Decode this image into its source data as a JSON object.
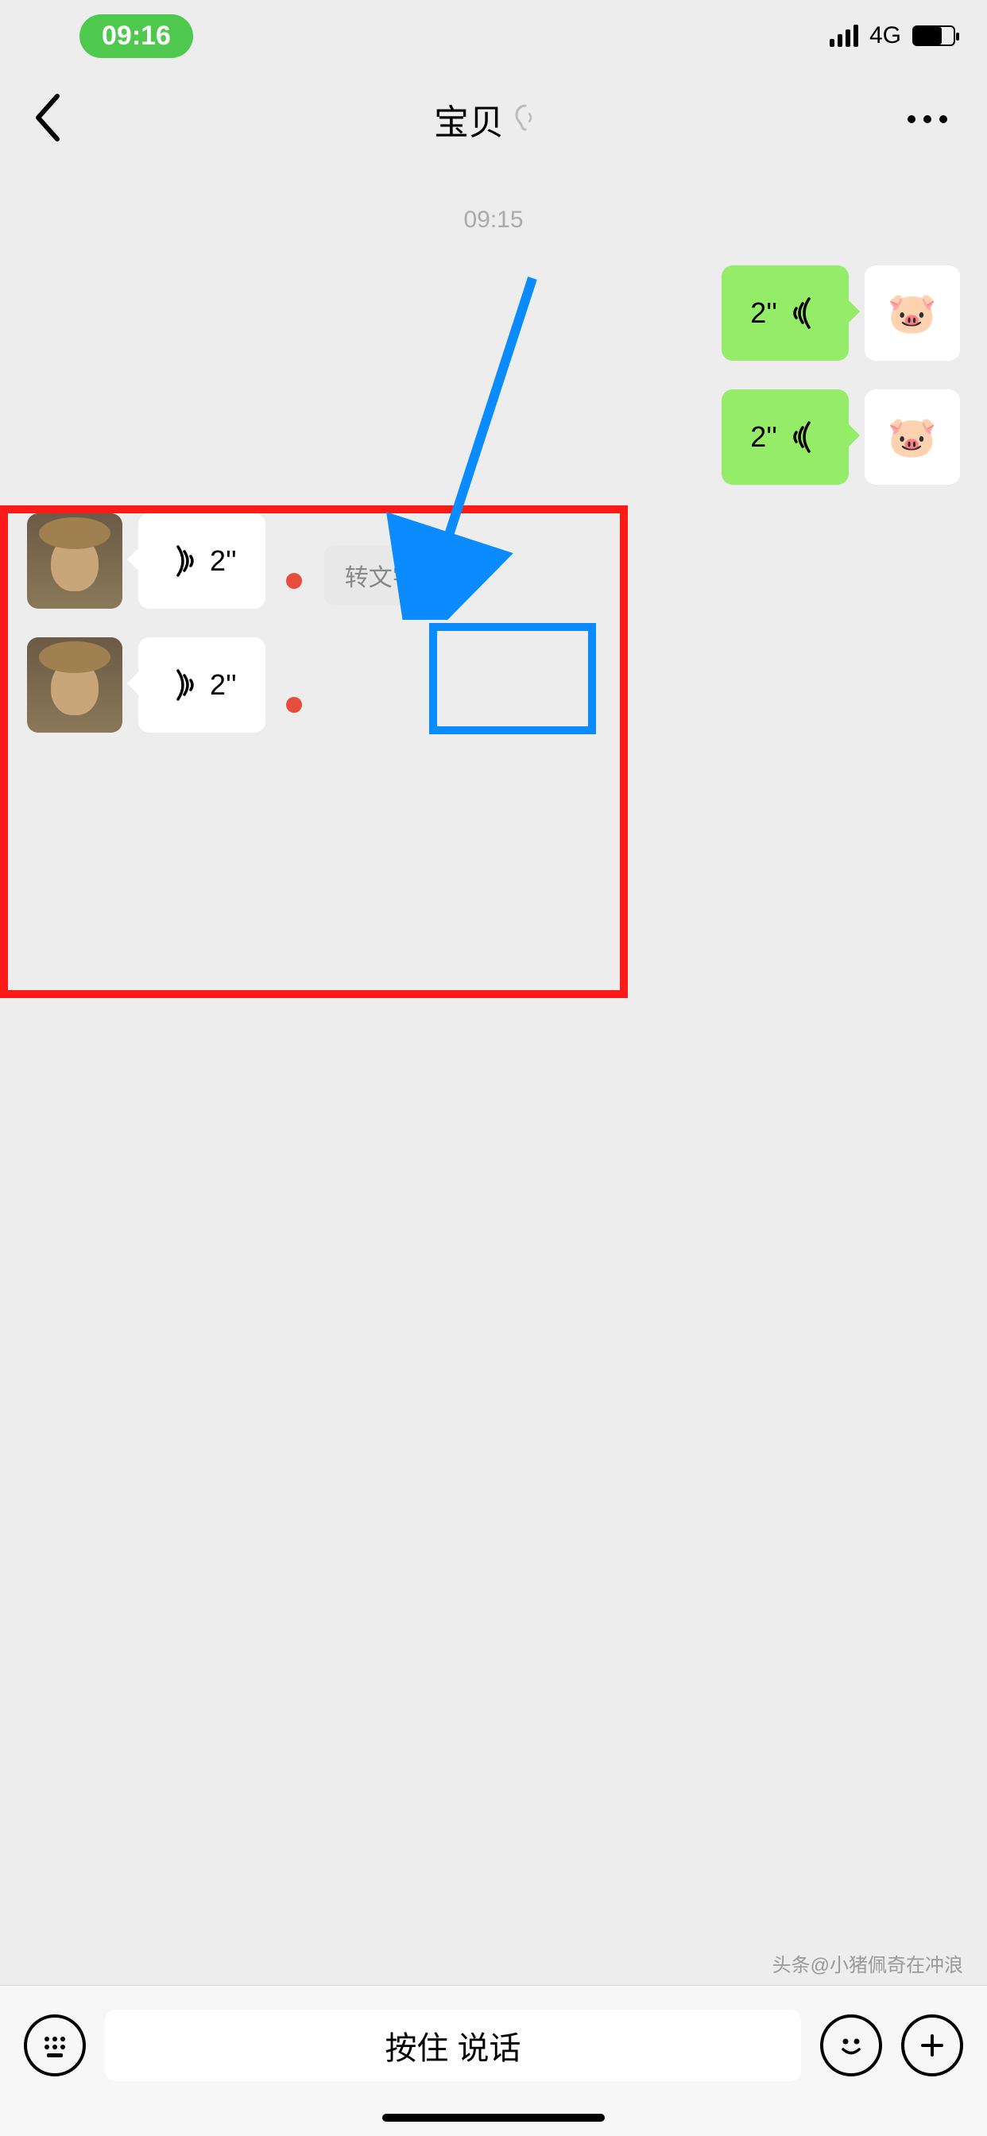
{
  "status": {
    "time": "09:16",
    "network": "4G"
  },
  "nav": {
    "title": "宝贝"
  },
  "chat": {
    "timestamp": "09:15",
    "messages": {
      "out1": {
        "duration": "2''"
      },
      "out2": {
        "duration": "2''"
      },
      "in1": {
        "duration": "2''",
        "convert_label": "转文字"
      },
      "in2": {
        "duration": "2''"
      }
    }
  },
  "input": {
    "hold_label": "按住 说话"
  },
  "watermark": "头条@小猪佩奇在冲浪"
}
